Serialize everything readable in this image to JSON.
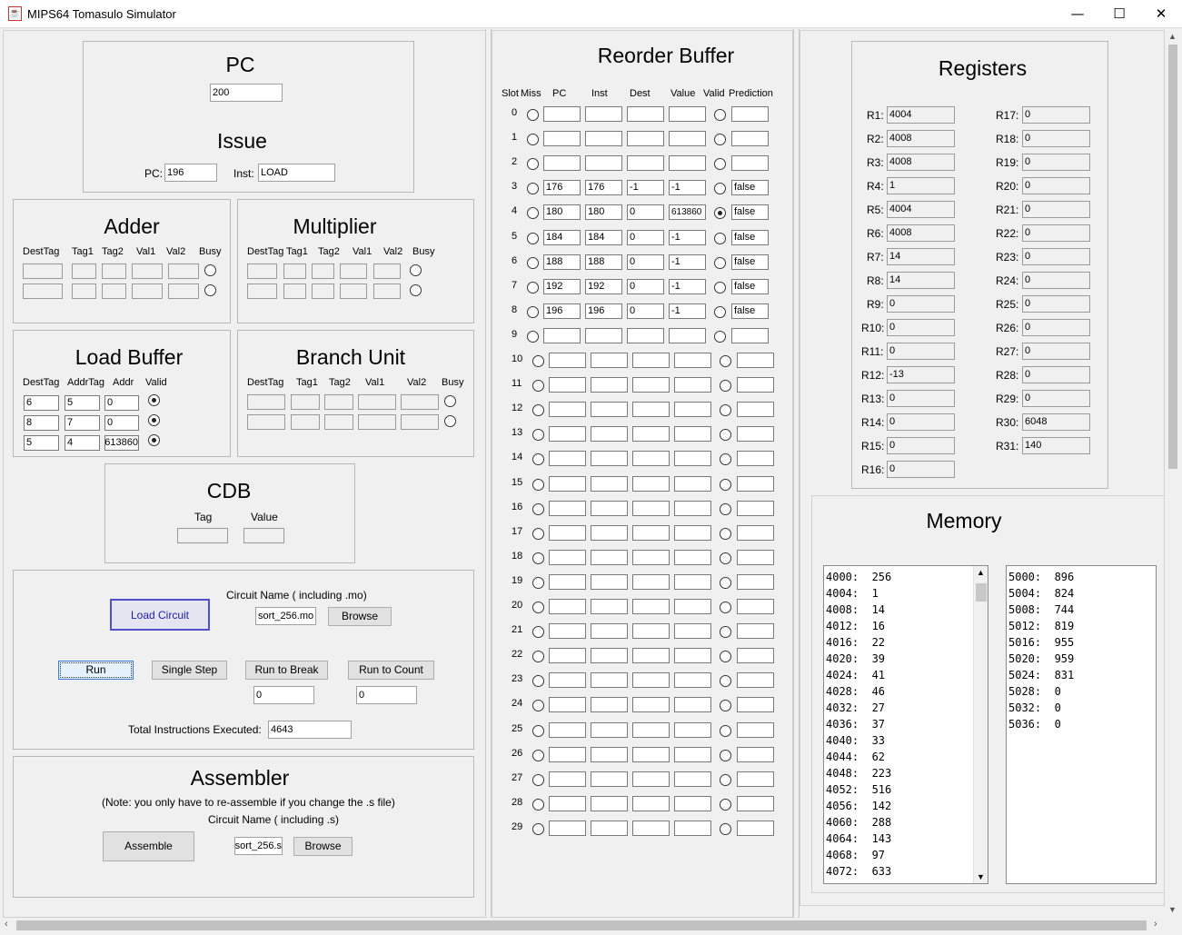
{
  "window": {
    "title": "MIPS64 Tomasulo Simulator",
    "minimize": "—",
    "maximize": "☐",
    "close": "✕"
  },
  "pc_panel": {
    "title": "PC",
    "pc": "200",
    "issue_title": "Issue",
    "pc_label": "PC:",
    "issue_pc": "196",
    "inst_label": "Inst:",
    "inst": "LOAD"
  },
  "adder": {
    "title": "Adder",
    "headers": [
      "DestTag",
      "Tag1",
      "Tag2",
      "Val1",
      "Val2",
      "Busy"
    ],
    "rows": [
      [
        "",
        "",
        "",
        "",
        ""
      ],
      [
        "",
        "",
        "",
        "",
        ""
      ]
    ],
    "busy": [
      false,
      false
    ]
  },
  "multiplier": {
    "title": "Multiplier",
    "headers": [
      "DestTag",
      "Tag1",
      "Tag2",
      "Val1",
      "Val2",
      "Busy"
    ],
    "rows": [
      [
        "",
        "",
        "",
        "",
        ""
      ],
      [
        "",
        "",
        "",
        "",
        ""
      ]
    ],
    "busy": [
      false,
      false
    ]
  },
  "load_buffer": {
    "title": "Load Buffer",
    "headers": [
      "DestTag",
      "AddrTag",
      "Addr",
      "Valid"
    ],
    "rows": [
      [
        "6",
        "5",
        "0"
      ],
      [
        "8",
        "7",
        "0"
      ],
      [
        "5",
        "4",
        "613860"
      ]
    ],
    "valid": [
      true,
      true,
      true
    ]
  },
  "branch_unit": {
    "title": "Branch Unit",
    "headers": [
      "DestTag",
      "Tag1",
      "Tag2",
      "Val1",
      "Val2",
      "Busy"
    ],
    "rows": [
      [
        "",
        "",
        "",
        "",
        ""
      ],
      [
        "",
        "",
        "",
        "",
        ""
      ]
    ],
    "busy": [
      false,
      false
    ]
  },
  "cdb": {
    "title": "CDB",
    "tag_label": "Tag",
    "value_label": "Value",
    "tag": "",
    "value": ""
  },
  "controls": {
    "circuit_label": "Circuit Name ( including .mo)",
    "circuit_file": "sort_256.mo",
    "load_circuit": "Load Circuit",
    "browse": "Browse",
    "run": "Run",
    "single_step": "Single Step",
    "run_to_break": "Run to Break",
    "run_to_count": "Run to Count",
    "break_value": "0",
    "count_value": "0",
    "total_label": "Total Instructions Executed:",
    "total": "4643"
  },
  "assembler": {
    "title": "Assembler",
    "note": "(Note: you only have to re-assemble if you change the .s file)",
    "circuit_label": "Circuit Name ( including .s)",
    "assemble": "Assemble",
    "file": "sort_256.s",
    "browse": "Browse"
  },
  "rob": {
    "title": "Reorder Buffer",
    "headers": [
      "Slot",
      "Miss",
      "PC",
      "Inst",
      "Dest",
      "Value",
      "Valid",
      "Prediction"
    ],
    "rows": [
      {
        "slot": "0",
        "miss": false,
        "pc": "",
        "inst": "",
        "dest": "",
        "value": "",
        "valid": false,
        "pred": ""
      },
      {
        "slot": "1",
        "miss": false,
        "pc": "",
        "inst": "",
        "dest": "",
        "value": "",
        "valid": false,
        "pred": ""
      },
      {
        "slot": "2",
        "miss": false,
        "pc": "",
        "inst": "",
        "dest": "",
        "value": "",
        "valid": false,
        "pred": ""
      },
      {
        "slot": "3",
        "miss": false,
        "pc": "176",
        "inst": "176",
        "dest": "-1",
        "value": "-1",
        "valid": false,
        "pred": "false"
      },
      {
        "slot": "4",
        "miss": false,
        "pc": "180",
        "inst": "180",
        "dest": "0",
        "value": "613860",
        "valid": true,
        "pred": "false"
      },
      {
        "slot": "5",
        "miss": false,
        "pc": "184",
        "inst": "184",
        "dest": "0",
        "value": "-1",
        "valid": false,
        "pred": "false"
      },
      {
        "slot": "6",
        "miss": false,
        "pc": "188",
        "inst": "188",
        "dest": "0",
        "value": "-1",
        "valid": false,
        "pred": "false"
      },
      {
        "slot": "7",
        "miss": false,
        "pc": "192",
        "inst": "192",
        "dest": "0",
        "value": "-1",
        "valid": false,
        "pred": "false"
      },
      {
        "slot": "8",
        "miss": false,
        "pc": "196",
        "inst": "196",
        "dest": "0",
        "value": "-1",
        "valid": false,
        "pred": "false"
      },
      {
        "slot": "9",
        "miss": false,
        "pc": "",
        "inst": "",
        "dest": "",
        "value": "",
        "valid": false,
        "pred": ""
      },
      {
        "slot": "10",
        "miss": false,
        "pc": "",
        "inst": "",
        "dest": "",
        "value": "",
        "valid": false,
        "pred": ""
      },
      {
        "slot": "11",
        "miss": false,
        "pc": "",
        "inst": "",
        "dest": "",
        "value": "",
        "valid": false,
        "pred": ""
      },
      {
        "slot": "12",
        "miss": false,
        "pc": "",
        "inst": "",
        "dest": "",
        "value": "",
        "valid": false,
        "pred": ""
      },
      {
        "slot": "13",
        "miss": false,
        "pc": "",
        "inst": "",
        "dest": "",
        "value": "",
        "valid": false,
        "pred": ""
      },
      {
        "slot": "14",
        "miss": false,
        "pc": "",
        "inst": "",
        "dest": "",
        "value": "",
        "valid": false,
        "pred": ""
      },
      {
        "slot": "15",
        "miss": false,
        "pc": "",
        "inst": "",
        "dest": "",
        "value": "",
        "valid": false,
        "pred": ""
      },
      {
        "slot": "16",
        "miss": false,
        "pc": "",
        "inst": "",
        "dest": "",
        "value": "",
        "valid": false,
        "pred": ""
      },
      {
        "slot": "17",
        "miss": false,
        "pc": "",
        "inst": "",
        "dest": "",
        "value": "",
        "valid": false,
        "pred": ""
      },
      {
        "slot": "18",
        "miss": false,
        "pc": "",
        "inst": "",
        "dest": "",
        "value": "",
        "valid": false,
        "pred": ""
      },
      {
        "slot": "19",
        "miss": false,
        "pc": "",
        "inst": "",
        "dest": "",
        "value": "",
        "valid": false,
        "pred": ""
      },
      {
        "slot": "20",
        "miss": false,
        "pc": "",
        "inst": "",
        "dest": "",
        "value": "",
        "valid": false,
        "pred": ""
      },
      {
        "slot": "21",
        "miss": false,
        "pc": "",
        "inst": "",
        "dest": "",
        "value": "",
        "valid": false,
        "pred": ""
      },
      {
        "slot": "22",
        "miss": false,
        "pc": "",
        "inst": "",
        "dest": "",
        "value": "",
        "valid": false,
        "pred": ""
      },
      {
        "slot": "23",
        "miss": false,
        "pc": "",
        "inst": "",
        "dest": "",
        "value": "",
        "valid": false,
        "pred": ""
      },
      {
        "slot": "24",
        "miss": false,
        "pc": "",
        "inst": "",
        "dest": "",
        "value": "",
        "valid": false,
        "pred": ""
      },
      {
        "slot": "25",
        "miss": false,
        "pc": "",
        "inst": "",
        "dest": "",
        "value": "",
        "valid": false,
        "pred": ""
      },
      {
        "slot": "26",
        "miss": false,
        "pc": "",
        "inst": "",
        "dest": "",
        "value": "",
        "valid": false,
        "pred": ""
      },
      {
        "slot": "27",
        "miss": false,
        "pc": "",
        "inst": "",
        "dest": "",
        "value": "",
        "valid": false,
        "pred": ""
      },
      {
        "slot": "28",
        "miss": false,
        "pc": "",
        "inst": "",
        "dest": "",
        "value": "",
        "valid": false,
        "pred": ""
      },
      {
        "slot": "29",
        "miss": false,
        "pc": "",
        "inst": "",
        "dest": "",
        "value": "",
        "valid": false,
        "pred": ""
      }
    ]
  },
  "registers": {
    "title": "Registers",
    "left": [
      [
        "R1:",
        "4004"
      ],
      [
        "R2:",
        "4008"
      ],
      [
        "R3:",
        "4008"
      ],
      [
        "R4:",
        "1"
      ],
      [
        "R5:",
        "4004"
      ],
      [
        "R6:",
        "4008"
      ],
      [
        "R7:",
        "14"
      ],
      [
        "R8:",
        "14"
      ],
      [
        "R9:",
        "0"
      ],
      [
        "R10:",
        "0"
      ],
      [
        "R11:",
        "0"
      ],
      [
        "R12:",
        "-13"
      ],
      [
        "R13:",
        "0"
      ],
      [
        "R14:",
        "0"
      ],
      [
        "R15:",
        "0"
      ],
      [
        "R16:",
        "0"
      ]
    ],
    "right": [
      [
        "R17:",
        "0"
      ],
      [
        "R18:",
        "0"
      ],
      [
        "R19:",
        "0"
      ],
      [
        "R20:",
        "0"
      ],
      [
        "R21:",
        "0"
      ],
      [
        "R22:",
        "0"
      ],
      [
        "R23:",
        "0"
      ],
      [
        "R24:",
        "0"
      ],
      [
        "R25:",
        "0"
      ],
      [
        "R26:",
        "0"
      ],
      [
        "R27:",
        "0"
      ],
      [
        "R28:",
        "0"
      ],
      [
        "R29:",
        "0"
      ],
      [
        "R30:",
        "6048"
      ],
      [
        "R31:",
        "140"
      ]
    ]
  },
  "memory": {
    "title": "Memory",
    "left": [
      "4000:  256",
      "4004:  1",
      "4008:  14",
      "4012:  16",
      "4016:  22",
      "4020:  39",
      "4024:  41",
      "4028:  46",
      "4032:  27",
      "4036:  37",
      "4040:  33",
      "4044:  62",
      "4048:  223",
      "4052:  516",
      "4056:  142",
      "4060:  288",
      "4064:  143",
      "4068:  97",
      "4072:  633"
    ],
    "right": [
      "5000:  896",
      "5004:  824",
      "5008:  744",
      "5012:  819",
      "5016:  955",
      "5020:  959",
      "5024:  831",
      "5028:  0",
      "5032:  0",
      "5036:  0"
    ]
  }
}
